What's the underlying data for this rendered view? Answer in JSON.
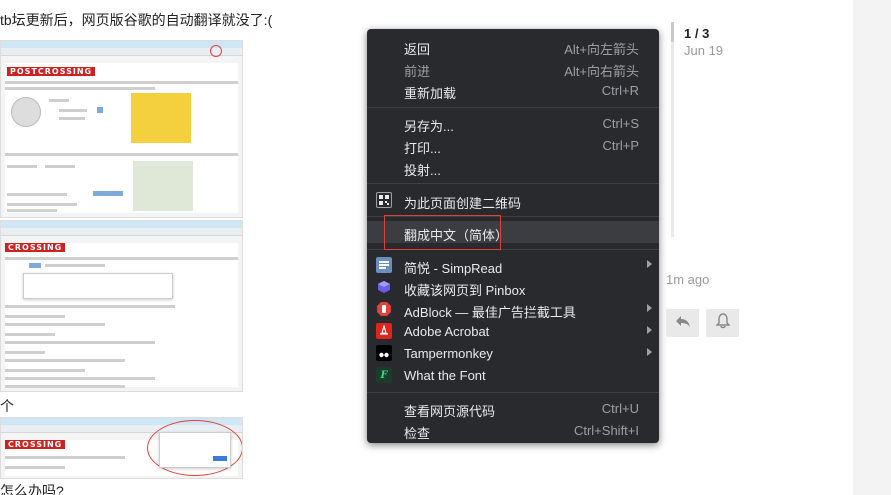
{
  "post": {
    "line1": "tb坛更新后，网页版谷歌的自动翻译就没了:(",
    "line2": "个",
    "line3": "怎么办吗?"
  },
  "embedded_screens": {
    "logo_text": "POSTCROSSING",
    "logo_text_2": "CROSSING"
  },
  "context_menu": {
    "items": [
      {
        "label": "返回",
        "shortcut": "Alt+向左箭头"
      },
      {
        "label": "前进",
        "shortcut": "Alt+向右箭头",
        "disabled": true
      },
      {
        "label": "重新加载",
        "shortcut": "Ctrl+R"
      },
      {
        "label": "另存为...",
        "shortcut": "Ctrl+S"
      },
      {
        "label": "打印...",
        "shortcut": "Ctrl+P"
      },
      {
        "label": "投射..."
      },
      {
        "label": "为此页面创建二维码",
        "icon": "qr-code-icon"
      },
      {
        "label": "翻成中文（简体）"
      },
      {
        "label": "简悦 - SimpRead",
        "icon": "simpread-icon",
        "submenu": true
      },
      {
        "label": "收藏该网页到 Pinbox",
        "icon": "pinbox-icon"
      },
      {
        "label": "AdBlock — 最佳广告拦截工具",
        "icon": "adblock-icon",
        "submenu": true
      },
      {
        "label": "Adobe Acrobat",
        "icon": "acrobat-icon",
        "submenu": true
      },
      {
        "label": "Tampermonkey",
        "icon": "tampermonkey-icon",
        "submenu": true
      },
      {
        "label": "What the Font",
        "icon": "whatthefont-icon"
      },
      {
        "label": "查看网页源代码",
        "shortcut": "Ctrl+U"
      },
      {
        "label": "检查",
        "shortcut": "Ctrl+Shift+I"
      }
    ]
  },
  "timeline": {
    "position": "1 / 3",
    "date": "Jun 19",
    "ago": "1m ago"
  },
  "colors": {
    "menu_bg": "#292a2d",
    "menu_text": "#e8eaed",
    "highlight_box": "#e0413b"
  }
}
